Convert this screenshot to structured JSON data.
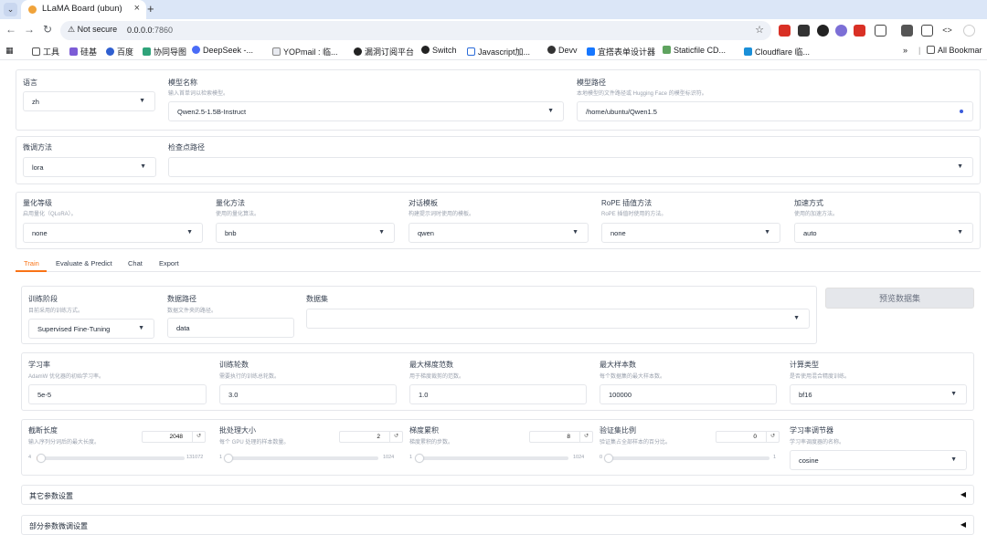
{
  "browser": {
    "tab_title": "LLaMA Board (ubun)",
    "security_label": "Not secure",
    "url_host": "0.0.0.0",
    "url_port": ":7860",
    "bookmarks": [
      "工具",
      "硅基",
      "百度",
      "协同导图",
      "DeepSeek -...",
      "YOPmail : 临...",
      "漏洞订阅平台",
      "Switch",
      "Javascript加...",
      "Devv",
      "宜搭表单设计器",
      "Staticfile CD...",
      "Cloudflare 临..."
    ],
    "bookmarks_overflow": "»",
    "all_bookmarks": "All Bookmar"
  },
  "model": {
    "lang_label": "语言",
    "lang_value": "zh",
    "name_label": "模型名称",
    "name_hint": "输入首单词以检索模型。",
    "name_value": "Qwen2.5-1.5B-Instruct",
    "path_label": "模型路径",
    "path_hint": "本地模型的文件路径或 Hugging Face 的模型标识符。",
    "path_value": "/home/ubuntu/Qwen1.5"
  },
  "finetune": {
    "method_label": "微调方法",
    "method_value": "lora",
    "ckpt_label": "检查点路径",
    "ckpt_value": ""
  },
  "quant": {
    "level_label": "量化等级",
    "level_hint": "启用量化（QLoRA）。",
    "level_value": "none",
    "method_label": "量化方法",
    "method_hint": "使用的量化算法。",
    "method_value": "bnb",
    "template_label": "对话模板",
    "template_hint": "构建提示词时使用的模板。",
    "template_value": "qwen",
    "rope_label": "RoPE 插值方法",
    "rope_hint": "RoPE 插值时使用的方法。",
    "rope_value": "none",
    "accel_label": "加速方式",
    "accel_hint": "使用的加速方法。",
    "accel_value": "auto"
  },
  "tabs": [
    "Train",
    "Evaluate & Predict",
    "Chat",
    "Export"
  ],
  "train": {
    "stage_label": "训练阶段",
    "stage_hint": "目前采用的训练方式。",
    "stage_value": "Supervised Fine-Tuning",
    "dir_label": "数据路径",
    "dir_hint": "数据文件夹的路径。",
    "dir_value": "data",
    "dataset_label": "数据集",
    "dataset_value": "",
    "preview_button": "预览数据集",
    "lr_label": "学习率",
    "lr_hint": "AdamW 优化器的初始学习率。",
    "lr_value": "5e-5",
    "epochs_label": "训练轮数",
    "epochs_hint": "需要执行的训练总轮数。",
    "epochs_value": "3.0",
    "grad_norm_label": "最大梯度范数",
    "grad_norm_hint": "用于梯度裁剪的范数。",
    "grad_norm_value": "1.0",
    "max_samples_label": "最大样本数",
    "max_samples_hint": "每个数据集的最大样本数。",
    "max_samples_value": "100000",
    "compute_label": "计算类型",
    "compute_hint": "是否使用混合精度训练。",
    "compute_value": "bf16"
  },
  "sliders": [
    {
      "label": "截断长度",
      "hint": "输入序列分词后的最大长度。",
      "value": "2048",
      "min": "4",
      "max": "131072",
      "fraction": 0.016
    },
    {
      "label": "批处理大小",
      "hint": "每个 GPU 处理的样本数量。",
      "value": "2",
      "min": "1",
      "max": "1024",
      "fraction": 0.001
    },
    {
      "label": "梯度累积",
      "hint": "梯度累积的步数。",
      "value": "8",
      "min": "1",
      "max": "1024",
      "fraction": 0.007
    },
    {
      "label": "验证集比例",
      "hint": "验证集占全部样本的百分比。",
      "value": "0",
      "min": "0",
      "max": "1",
      "fraction": 0.0
    }
  ],
  "scheduler": {
    "label": "学习率调节器",
    "hint": "学习率调度器的名称。",
    "value": "cosine"
  },
  "accordions": [
    "其它参数设置",
    "部分参数微调设置"
  ],
  "icons": {
    "reset": "↺",
    "caret": "▼",
    "collapse": "◀"
  },
  "colors": {
    "accent": "#f97316",
    "tabbar": "#dbe6f7"
  }
}
